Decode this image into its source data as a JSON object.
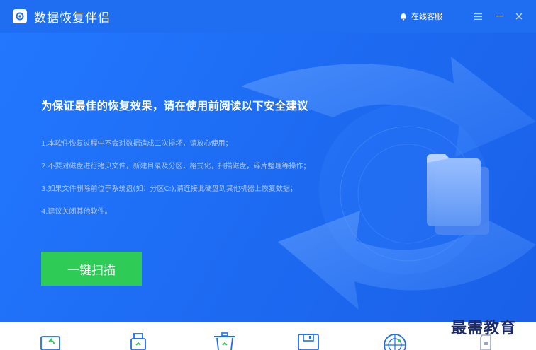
{
  "titlebar": {
    "app_title": "数据恢复伴侣",
    "service_label": "在线客服",
    "logo_icon": "camera-restore-icon",
    "menu_icon": "hamburger-menu-icon",
    "minimize_icon": "minimize-icon",
    "close_icon": "close-icon"
  },
  "main": {
    "headline": "为保证最佳的恢复效果，请在使用前阅读以下安全建议",
    "tips": [
      "1.本软件恢复过程中不会对数据造成二次损坏，请放心使用；",
      "2.不要对磁盘进行拷贝文件，新建目录及分区，格式化，扫描磁盘，碎片整理等操作；",
      "3.如果文件删除前位于系统盘(如：分区C:),请连接此硬盘到其他机器上恢复数据；",
      "4.建议关闭其他软件。"
    ],
    "scan_button_label": "一键扫描",
    "illustration": "circular-arrows-folder-illustration"
  },
  "bottom_icons": [
    "restore-icon",
    "usb-drive-icon",
    "recycle-bin-icon",
    "floppy-disk-icon",
    "radar-scan-icon",
    "sd-card-icon"
  ],
  "watermark": "最需教育",
  "colors": {
    "titlebar": "#1f6ef2",
    "hero": "#1d6af1",
    "scan_button": "#2ecb57",
    "tip_text": "#a9c6f8"
  }
}
